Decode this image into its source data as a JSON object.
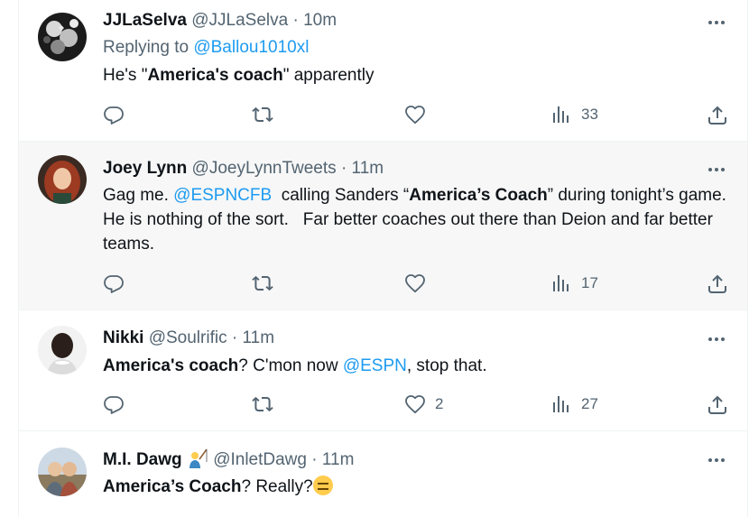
{
  "tweets": [
    {
      "display_name": "JJLaSelva",
      "handle": "@JJLaSelva",
      "separator": "·",
      "time": "10m",
      "replying_prefix": "Replying to",
      "replying_to": "@Ballou1010xl",
      "text": {
        "p1": "He's \"",
        "b1": "America's coach",
        "p2": "\" apparently"
      },
      "views": "33"
    },
    {
      "display_name": "Joey Lynn",
      "handle": "@JoeyLynnTweets",
      "separator": "·",
      "time": "11m",
      "text": {
        "p1": "Gag me. ",
        "mention": "@ESPNCFB",
        "p2": "  calling Sanders “",
        "b1": "America’s Coach",
        "p3": "” during tonight’s game. He is nothing of the sort.   Far better coaches out there than Deion and far better teams."
      },
      "views": "17"
    },
    {
      "display_name": "Nikki",
      "handle": "@Soulrific",
      "separator": "·",
      "time": "11m",
      "text": {
        "b1": "America's coach",
        "p1": "? C'mon now ",
        "mention": "@ESPN",
        "p2": ", stop that."
      },
      "likes": "2",
      "views": "27"
    },
    {
      "display_name": "M.I. Dawg",
      "name_emoji": "fishing-person-emoji",
      "handle": "@InletDawg",
      "separator": "·",
      "time": "11m",
      "text": {
        "b1": "America’s Coach",
        "p1": "? Really?"
      },
      "trailing_emoji": "expressionless-face-emoji"
    }
  ],
  "icons": {
    "more": "more-horizontal-icon",
    "reply": "reply-icon",
    "retweet": "retweet-icon",
    "like": "heart-icon",
    "views": "views-chart-icon",
    "share": "share-icon"
  },
  "colors": {
    "link": "#1d9bf0",
    "secondary_text": "#536471",
    "primary_text": "#0f1419",
    "hover_row_bg": "#f7f7f7"
  }
}
